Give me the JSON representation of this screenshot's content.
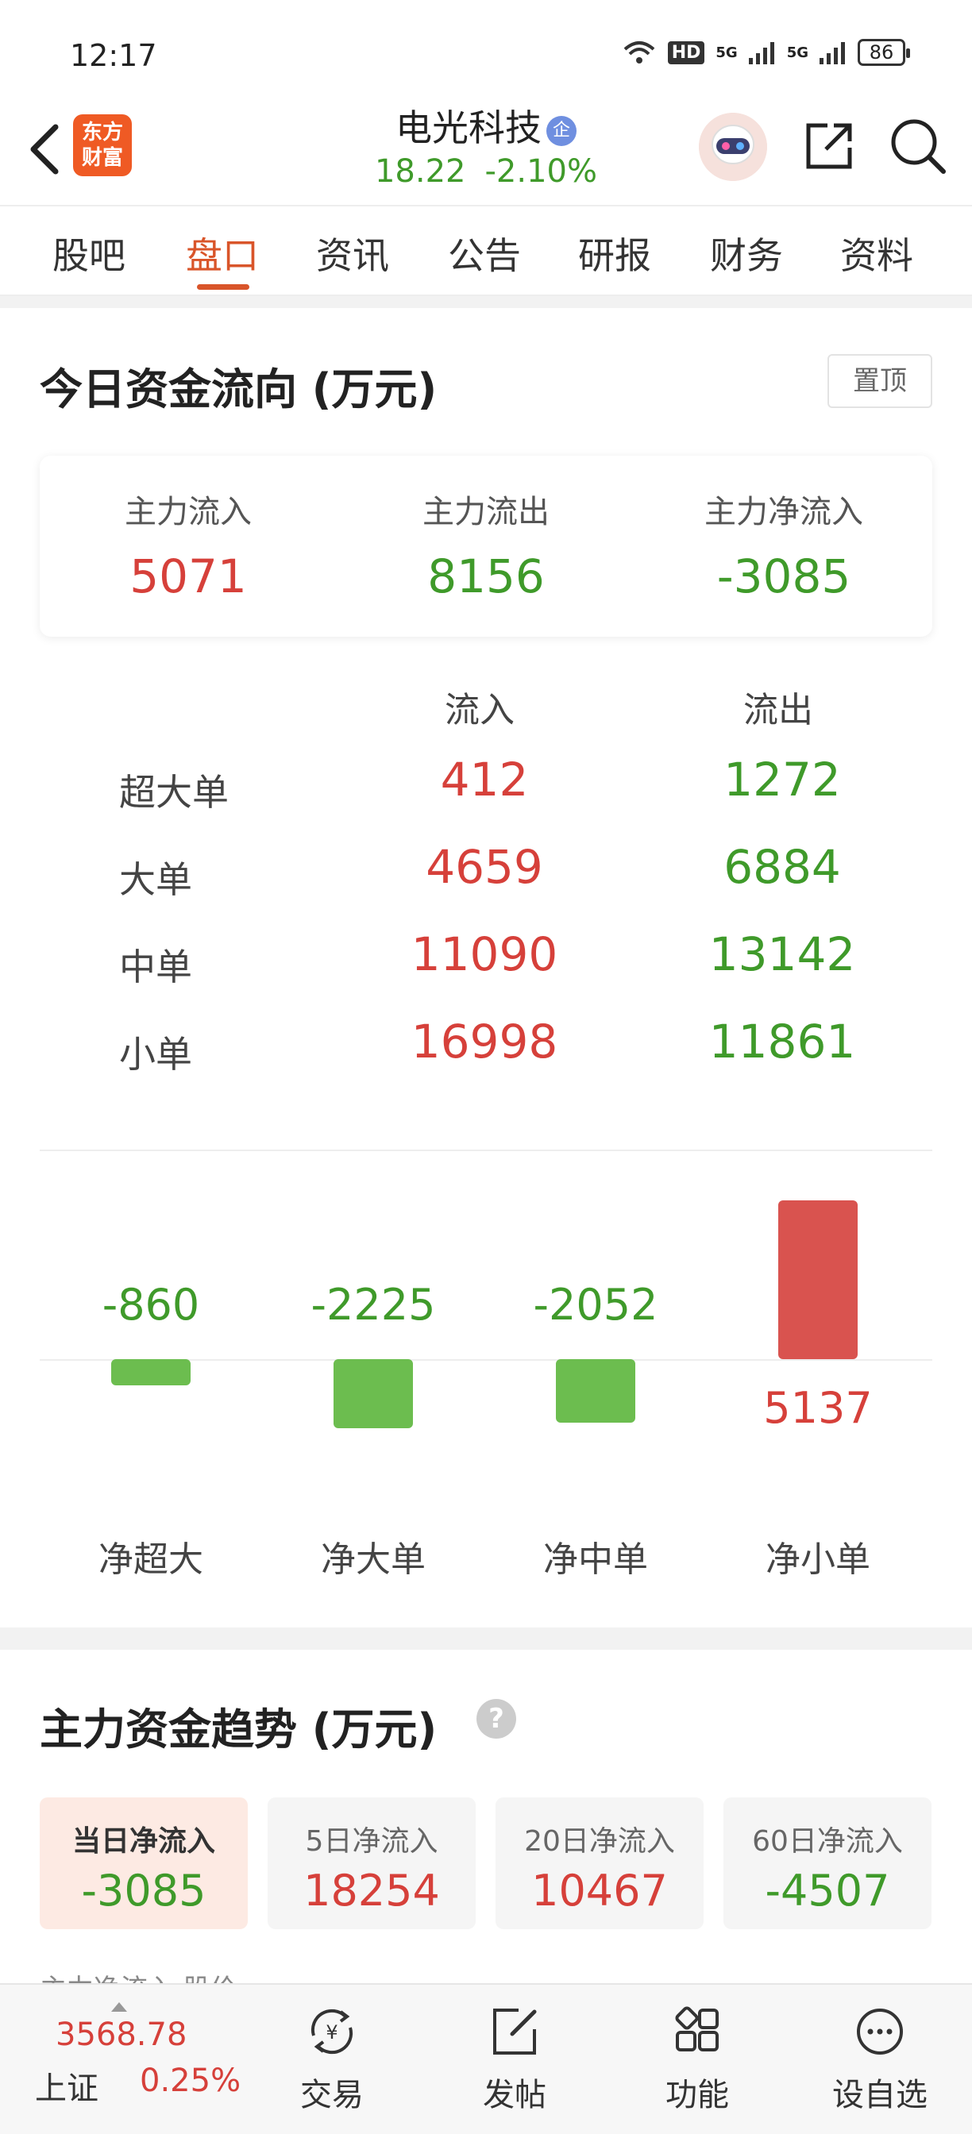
{
  "status_bar": {
    "time": "12:17",
    "battery": "86",
    "net1": "HD",
    "net2": "5G",
    "net3": "5G"
  },
  "header": {
    "logo_line1": "东方",
    "logo_line2": "财富",
    "stock_name": "电光科技",
    "badge": "企",
    "price": "18.22",
    "change_pct": "-2.10%"
  },
  "tabs": [
    {
      "label": "股吧"
    },
    {
      "label": "盘口"
    },
    {
      "label": "资讯"
    },
    {
      "label": "公告"
    },
    {
      "label": "研报"
    },
    {
      "label": "财务"
    },
    {
      "label": "资料"
    }
  ],
  "active_tab": "盘口",
  "fund_flow": {
    "title": "今日资金流向 (万元)",
    "pin_label": "置顶",
    "summary": [
      {
        "label": "主力流入",
        "value": "5071"
      },
      {
        "label": "主力流出",
        "value": "8156"
      },
      {
        "label": "主力净流入",
        "value": "-3085"
      }
    ],
    "col_in": "流入",
    "col_out": "流出",
    "rows": [
      {
        "label": "超大单",
        "in": "412",
        "out": "1272"
      },
      {
        "label": "大单",
        "in": "4659",
        "out": "6884"
      },
      {
        "label": "中单",
        "in": "11090",
        "out": "13142"
      },
      {
        "label": "小单",
        "in": "16998",
        "out": "11861"
      }
    ]
  },
  "chart_data": {
    "type": "bar",
    "categories": [
      "净超大",
      "净大单",
      "净中单",
      "净小单"
    ],
    "values": [
      -860,
      -2225,
      -2052,
      5137
    ],
    "value_labels": [
      "-860",
      "-2225",
      "-2052",
      "5137"
    ],
    "colors": {
      "positive": "#d9534f",
      "negative": "#6cbd4f"
    }
  },
  "trend": {
    "title": "主力资金趋势 (万元)",
    "help": "?",
    "boxes": [
      {
        "label": "当日净流入",
        "value": "-3085"
      },
      {
        "label": "5日净流入",
        "value": "18254"
      },
      {
        "label": "20日净流入",
        "value": "10467"
      },
      {
        "label": "60日净流入",
        "value": "-4507"
      }
    ],
    "partial_row": "主力净流入        股价"
  },
  "bottom_bar": {
    "index_value": "3568.78",
    "index_name": "上证",
    "index_change": "0.25%",
    "nav": [
      {
        "label": "交易",
        "icon": "yuan-exchange-icon"
      },
      {
        "label": "发帖",
        "icon": "edit-post-icon"
      },
      {
        "label": "功能",
        "icon": "grid-function-icon"
      },
      {
        "label": "设自选",
        "icon": "more-dots-icon"
      }
    ]
  },
  "colors": {
    "accent": "#d9552a",
    "up": "#d6403a",
    "down": "#3f9a2a"
  }
}
